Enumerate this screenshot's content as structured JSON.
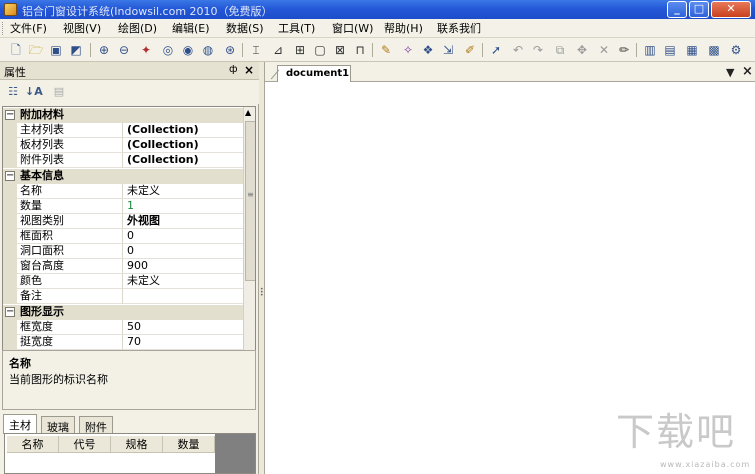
{
  "window": {
    "title": "铝合门窗设计系统(Indowsil.com 2010（免费版）",
    "min_glyph": "_",
    "max_glyph": "□",
    "close_glyph": "✕"
  },
  "menu": [
    "文件(F)",
    "视图(V)",
    "绘图(D)",
    "编辑(E)",
    "数据(S)",
    "工具(T)",
    "窗口(W)",
    "帮助(H)",
    "联系我们"
  ],
  "toolbar_icons": [
    "new-icon",
    "open-icon",
    "save-icon",
    "saveall-icon",
    "zoom-in-icon",
    "zoom-out-icon",
    "zoom-extents-icon",
    "zoom-window-icon",
    "zoom-all-icon",
    "zoom-prev-icon",
    "zoom-fit-icon",
    "frame-icon",
    "measure-icon",
    "dimension-icon",
    "box-icon",
    "grid-icon",
    "door-icon",
    "insert-icon",
    "wand-icon",
    "render-icon",
    "export-icon",
    "edit-icon",
    "select-icon",
    "undo-icon",
    "redo-icon",
    "copy-icon",
    "move-icon",
    "delete-icon",
    "pencil-icon",
    "view1-icon",
    "view2-icon",
    "view3-icon",
    "table-icon",
    "settings-icon"
  ],
  "properties_panel": {
    "title": "属性",
    "pin_glyph": "ф",
    "close_glyph": "×",
    "categories": [
      {
        "name": "附加材料",
        "rows": [
          {
            "name": "主材列表",
            "value": "(Collection)",
            "bold": true
          },
          {
            "name": "板材列表",
            "value": "(Collection)",
            "bold": true
          },
          {
            "name": "附件列表",
            "value": "(Collection)",
            "bold": true
          }
        ]
      },
      {
        "name": "基本信息",
        "rows": [
          {
            "name": "名称",
            "value": "未定义"
          },
          {
            "name": "数量",
            "value": "1",
            "green": true
          },
          {
            "name": "视图类别",
            "value": "外视图",
            "bold": true
          },
          {
            "name": "框面积",
            "value": "0"
          },
          {
            "name": "洞口面积",
            "value": "0"
          },
          {
            "name": "窗台高度",
            "value": "900"
          },
          {
            "name": "颜色",
            "value": "未定义"
          },
          {
            "name": "备注",
            "value": ""
          }
        ]
      },
      {
        "name": "图形显示",
        "rows": [
          {
            "name": "框宽度",
            "value": "50"
          },
          {
            "name": "挺宽度",
            "value": "70"
          }
        ]
      }
    ],
    "description": {
      "title": "名称",
      "text": "当前图形的标识名称"
    },
    "tabs": [
      "主材",
      "玻璃",
      "附件"
    ],
    "table_columns": [
      "名称",
      "代号",
      "规格",
      "数量"
    ]
  },
  "document": {
    "tab_label": "document1",
    "dropdown_glyph": "▼",
    "close_glyph": "×"
  },
  "watermark": {
    "logo": "下载吧",
    "url": "www.xiazaiba.com"
  }
}
